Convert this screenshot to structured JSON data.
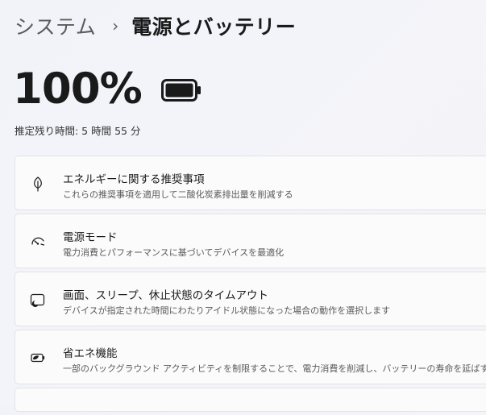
{
  "breadcrumb": {
    "parent": "システム",
    "separator": "›",
    "current": "電源とバッテリー"
  },
  "battery": {
    "percent_label": "100%",
    "level": 1.0,
    "remaining": "推定残り時間: 5 時間 55 分"
  },
  "cards": [
    {
      "icon": "leaf-icon",
      "title": "エネルギーに関する推奨事項",
      "subtitle": "これらの推奨事項を適用して二酸化炭素排出量を削減する"
    },
    {
      "icon": "speedometer-icon",
      "title": "電源モード",
      "subtitle": "電力消費とパフォーマンスに基づいてデバイスを最適化"
    },
    {
      "icon": "screen-sleep-icon",
      "title": "画面、スリープ、休止状態のタイムアウト",
      "subtitle": "デバイスが指定された時間にわたりアイドル状態になった場合の動作を選択します"
    },
    {
      "icon": "battery-saver-icon",
      "title": "省エネ機能",
      "subtitle": "一部のバックグラウンド アクティビティを制限することで、電力消費を削減し、バッテリーの寿命を延ばす"
    }
  ]
}
